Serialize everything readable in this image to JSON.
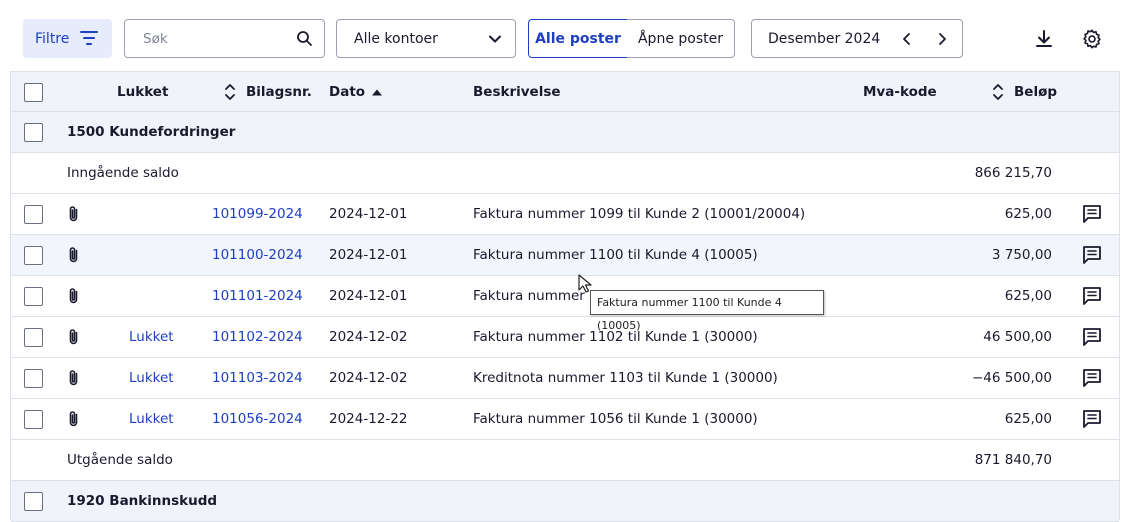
{
  "toolbar": {
    "filter_label": "Filtre",
    "search_placeholder": "Søk",
    "account_select": "Alle kontoer",
    "seg_all": "Alle poster",
    "seg_open": "Åpne poster",
    "period_label": "Desember 2024"
  },
  "header": {
    "closed": "Lukket",
    "voucher": "Bilagsnr.",
    "date": "Dato",
    "description": "Beskrivelse",
    "vat": "Mva-kode",
    "amount": "Beløp"
  },
  "groups": [
    {
      "title": "1500 Kundefordringer"
    },
    {
      "title": "1920 Bankinnskudd"
    }
  ],
  "opening": {
    "label": "Inngående saldo",
    "amount": "866 215,70"
  },
  "closing": {
    "label": "Utgående saldo",
    "amount": "871 840,70"
  },
  "rows": [
    {
      "closed": "",
      "voucher": "101099-2024",
      "date": "2024-12-01",
      "desc": "Faktura nummer 1099 til Kunde 2 (10001/20004)",
      "amount": "625,00"
    },
    {
      "closed": "",
      "voucher": "101100-2024",
      "date": "2024-12-01",
      "desc": "Faktura nummer 1100 til Kunde 4 (10005)",
      "amount": "3 750,00"
    },
    {
      "closed": "",
      "voucher": "101101-2024",
      "date": "2024-12-01",
      "desc": "Faktura nummer 1",
      "amount": "625,00"
    },
    {
      "closed": "Lukket",
      "voucher": "101102-2024",
      "date": "2024-12-02",
      "desc": "Faktura nummer 1102 til Kunde 1 (30000)",
      "amount": "46 500,00"
    },
    {
      "closed": "Lukket",
      "voucher": "101103-2024",
      "date": "2024-12-02",
      "desc": "Kreditnota nummer 1103 til Kunde 1 (30000)",
      "amount": "−46 500,00"
    },
    {
      "closed": "Lukket",
      "voucher": "101056-2024",
      "date": "2024-12-22",
      "desc": "Faktura nummer 1056 til Kunde 1 (30000)",
      "amount": "625,00"
    }
  ],
  "tooltip": "Faktura nummer 1100 til Kunde 4 (10005)",
  "colors": {
    "accent": "#1e40c0",
    "header_bg": "#f0f3fa",
    "border": "#dde1ea"
  }
}
